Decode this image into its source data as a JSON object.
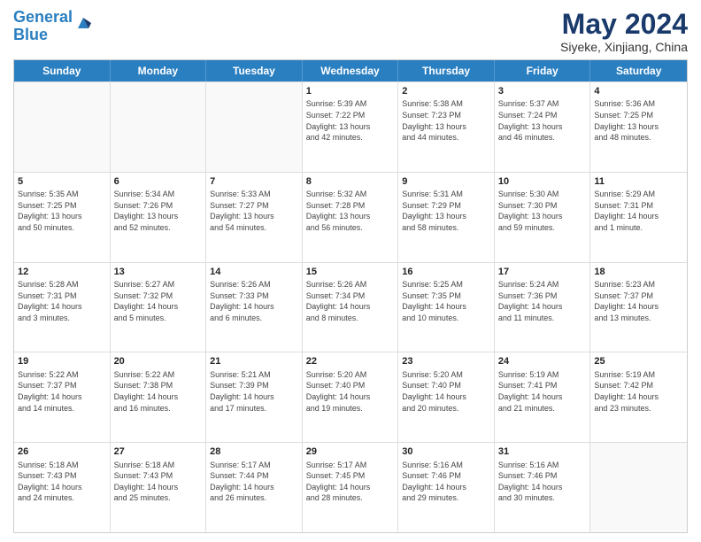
{
  "header": {
    "logo_line1": "General",
    "logo_line2": "Blue",
    "month_title": "May 2024",
    "location": "Siyeke, Xinjiang, China"
  },
  "weekdays": [
    "Sunday",
    "Monday",
    "Tuesday",
    "Wednesday",
    "Thursday",
    "Friday",
    "Saturday"
  ],
  "rows": [
    [
      {
        "day": "",
        "info": ""
      },
      {
        "day": "",
        "info": ""
      },
      {
        "day": "",
        "info": ""
      },
      {
        "day": "1",
        "info": "Sunrise: 5:39 AM\nSunset: 7:22 PM\nDaylight: 13 hours\nand 42 minutes."
      },
      {
        "day": "2",
        "info": "Sunrise: 5:38 AM\nSunset: 7:23 PM\nDaylight: 13 hours\nand 44 minutes."
      },
      {
        "day": "3",
        "info": "Sunrise: 5:37 AM\nSunset: 7:24 PM\nDaylight: 13 hours\nand 46 minutes."
      },
      {
        "day": "4",
        "info": "Sunrise: 5:36 AM\nSunset: 7:25 PM\nDaylight: 13 hours\nand 48 minutes."
      }
    ],
    [
      {
        "day": "5",
        "info": "Sunrise: 5:35 AM\nSunset: 7:25 PM\nDaylight: 13 hours\nand 50 minutes."
      },
      {
        "day": "6",
        "info": "Sunrise: 5:34 AM\nSunset: 7:26 PM\nDaylight: 13 hours\nand 52 minutes."
      },
      {
        "day": "7",
        "info": "Sunrise: 5:33 AM\nSunset: 7:27 PM\nDaylight: 13 hours\nand 54 minutes."
      },
      {
        "day": "8",
        "info": "Sunrise: 5:32 AM\nSunset: 7:28 PM\nDaylight: 13 hours\nand 56 minutes."
      },
      {
        "day": "9",
        "info": "Sunrise: 5:31 AM\nSunset: 7:29 PM\nDaylight: 13 hours\nand 58 minutes."
      },
      {
        "day": "10",
        "info": "Sunrise: 5:30 AM\nSunset: 7:30 PM\nDaylight: 13 hours\nand 59 minutes."
      },
      {
        "day": "11",
        "info": "Sunrise: 5:29 AM\nSunset: 7:31 PM\nDaylight: 14 hours\nand 1 minute."
      }
    ],
    [
      {
        "day": "12",
        "info": "Sunrise: 5:28 AM\nSunset: 7:31 PM\nDaylight: 14 hours\nand 3 minutes."
      },
      {
        "day": "13",
        "info": "Sunrise: 5:27 AM\nSunset: 7:32 PM\nDaylight: 14 hours\nand 5 minutes."
      },
      {
        "day": "14",
        "info": "Sunrise: 5:26 AM\nSunset: 7:33 PM\nDaylight: 14 hours\nand 6 minutes."
      },
      {
        "day": "15",
        "info": "Sunrise: 5:26 AM\nSunset: 7:34 PM\nDaylight: 14 hours\nand 8 minutes."
      },
      {
        "day": "16",
        "info": "Sunrise: 5:25 AM\nSunset: 7:35 PM\nDaylight: 14 hours\nand 10 minutes."
      },
      {
        "day": "17",
        "info": "Sunrise: 5:24 AM\nSunset: 7:36 PM\nDaylight: 14 hours\nand 11 minutes."
      },
      {
        "day": "18",
        "info": "Sunrise: 5:23 AM\nSunset: 7:37 PM\nDaylight: 14 hours\nand 13 minutes."
      }
    ],
    [
      {
        "day": "19",
        "info": "Sunrise: 5:22 AM\nSunset: 7:37 PM\nDaylight: 14 hours\nand 14 minutes."
      },
      {
        "day": "20",
        "info": "Sunrise: 5:22 AM\nSunset: 7:38 PM\nDaylight: 14 hours\nand 16 minutes."
      },
      {
        "day": "21",
        "info": "Sunrise: 5:21 AM\nSunset: 7:39 PM\nDaylight: 14 hours\nand 17 minutes."
      },
      {
        "day": "22",
        "info": "Sunrise: 5:20 AM\nSunset: 7:40 PM\nDaylight: 14 hours\nand 19 minutes."
      },
      {
        "day": "23",
        "info": "Sunrise: 5:20 AM\nSunset: 7:40 PM\nDaylight: 14 hours\nand 20 minutes."
      },
      {
        "day": "24",
        "info": "Sunrise: 5:19 AM\nSunset: 7:41 PM\nDaylight: 14 hours\nand 21 minutes."
      },
      {
        "day": "25",
        "info": "Sunrise: 5:19 AM\nSunset: 7:42 PM\nDaylight: 14 hours\nand 23 minutes."
      }
    ],
    [
      {
        "day": "26",
        "info": "Sunrise: 5:18 AM\nSunset: 7:43 PM\nDaylight: 14 hours\nand 24 minutes."
      },
      {
        "day": "27",
        "info": "Sunrise: 5:18 AM\nSunset: 7:43 PM\nDaylight: 14 hours\nand 25 minutes."
      },
      {
        "day": "28",
        "info": "Sunrise: 5:17 AM\nSunset: 7:44 PM\nDaylight: 14 hours\nand 26 minutes."
      },
      {
        "day": "29",
        "info": "Sunrise: 5:17 AM\nSunset: 7:45 PM\nDaylight: 14 hours\nand 28 minutes."
      },
      {
        "day": "30",
        "info": "Sunrise: 5:16 AM\nSunset: 7:46 PM\nDaylight: 14 hours\nand 29 minutes."
      },
      {
        "day": "31",
        "info": "Sunrise: 5:16 AM\nSunset: 7:46 PM\nDaylight: 14 hours\nand 30 minutes."
      },
      {
        "day": "",
        "info": ""
      }
    ]
  ]
}
